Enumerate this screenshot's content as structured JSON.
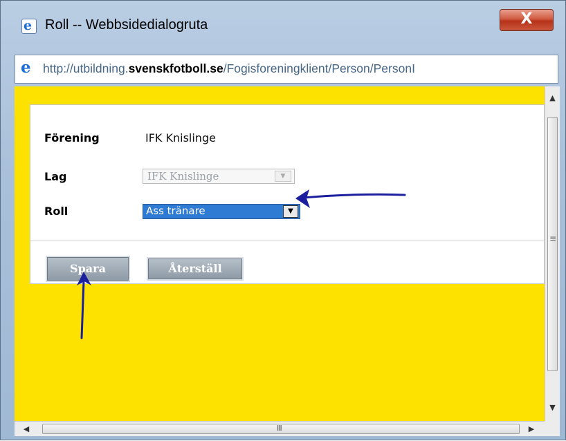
{
  "window": {
    "title": "Roll -- Webbsidedialogruta",
    "close_label": "X"
  },
  "addressbar": {
    "url_prefix": "http://utbildning.",
    "url_domain": "svenskfotboll.se",
    "url_path": "/Fogisforeningklient/Person/PersonI"
  },
  "form": {
    "forening_label": "Förening",
    "forening_value": "IFK Knislinge",
    "lag_label": "Lag",
    "lag_value": "IFK Knislinge",
    "roll_label": "Roll",
    "roll_value": "Ass tränare"
  },
  "buttons": {
    "save_label": "Spara",
    "reset_label": "Återställ"
  },
  "scrollbar": {
    "grip_h": "III",
    "grip_v": "≡"
  },
  "colors": {
    "content_bg": "#fde200",
    "selected_bg": "#2e7bd3",
    "annotation": "#1b1f9e"
  },
  "icons": [
    "ie-icon",
    "close-icon",
    "scroll-up-icon",
    "scroll-down-icon",
    "scroll-left-icon",
    "scroll-right-icon",
    "arrow-annotation"
  ]
}
